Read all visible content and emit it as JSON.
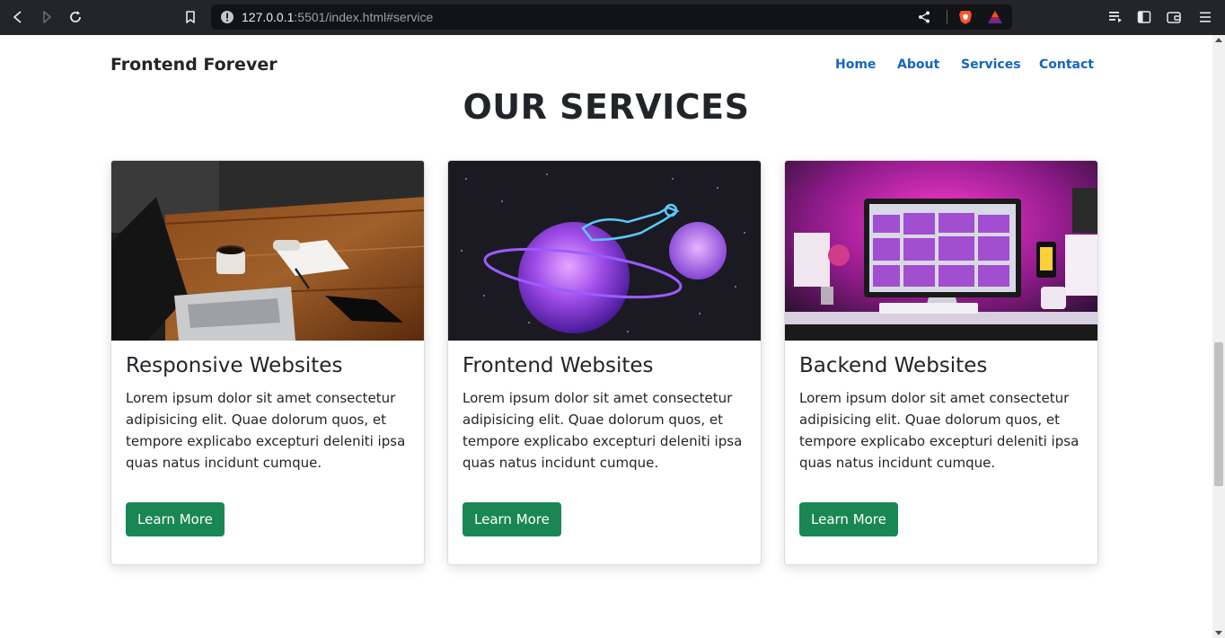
{
  "browser": {
    "url_host": "127.0.0.1",
    "url_rest": ":5501/index.html#service"
  },
  "nav": {
    "brand": "Frontend Forever",
    "links": [
      "Home",
      "About",
      "Services",
      "Contact"
    ]
  },
  "section": {
    "title": "OUR SERVICES"
  },
  "cards": [
    {
      "image": "laptop-desk-photo",
      "title": "Responsive Websites",
      "text": "Lorem ipsum dolor sit amet consectetur adipisicing elit. Quae dolorum quos, et tempore explicabo excepturi deleniti ipsa quas natus incidunt cumque.",
      "button": "Learn More"
    },
    {
      "image": "neon-planet-illustration",
      "title": "Frontend Websites",
      "text": "Lorem ipsum dolor sit amet consectetur adipisicing elit. Quae dolorum quos, et tempore explicabo excepturi deleniti ipsa quas natus incidunt cumque.",
      "button": "Learn More"
    },
    {
      "image": "pink-desktop-setup-photo",
      "title": "Backend Websites",
      "text": "Lorem ipsum dolor sit amet consectetur adipisicing elit. Quae dolorum quos, et tempore explicabo excepturi deleniti ipsa quas natus incidunt cumque.",
      "button": "Learn More"
    }
  ],
  "colors": {
    "nav_link": "#1565c0",
    "button": "#198754",
    "heading": "#212529"
  }
}
